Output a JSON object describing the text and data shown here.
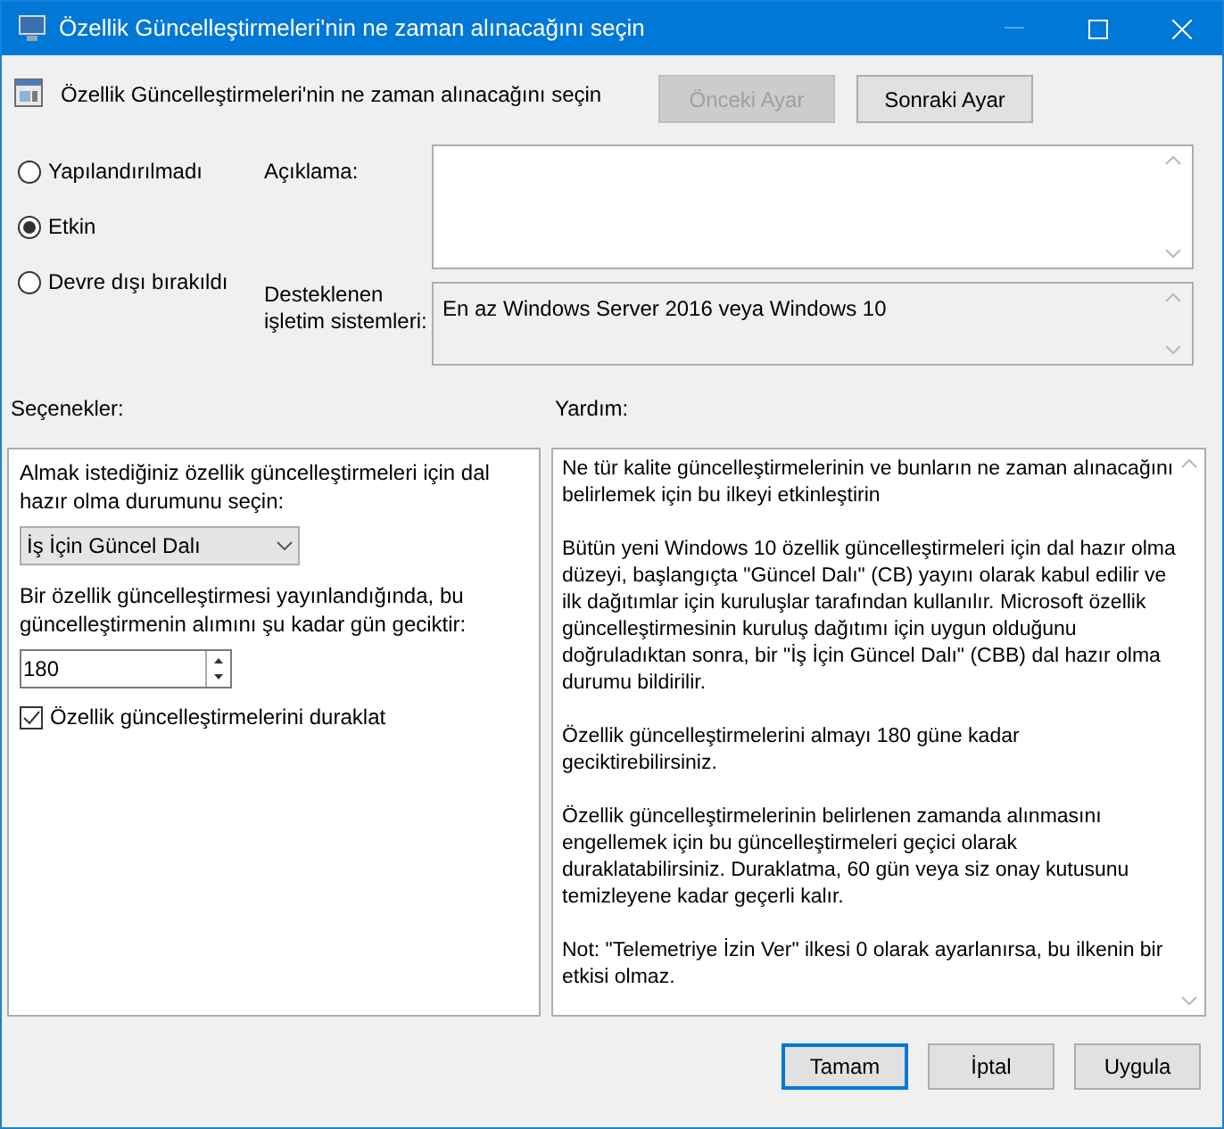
{
  "window": {
    "title": "Özellik Güncelleştirmeleri'nin ne zaman alınacağını seçin"
  },
  "header": {
    "title": "Özellik Güncelleştirmeleri'nin ne zaman alınacağını seçin",
    "buttons": [
      {
        "label": "Önceki Ayar",
        "disabled": true
      },
      {
        "label": "Sonraki Ayar",
        "disabled": false
      }
    ]
  },
  "state_options": [
    {
      "label": "Yapılandırılmadı",
      "selected": false
    },
    {
      "label": "Etkin",
      "selected": true
    },
    {
      "label": "Devre dışı bırakıldı",
      "selected": false
    }
  ],
  "description": {
    "label": "Açıklama:"
  },
  "supported": {
    "label": "Desteklenen işletim sistemleri:",
    "value": "En az Windows Server 2016 veya Windows 10"
  },
  "options": {
    "label": "Seçenekler:",
    "items": [
      {
        "kind": "text",
        "text": "Almak istediğiniz özellik güncelleştirmeleri için dal hazır olma durumunu seçin:"
      },
      {
        "kind": "dropdown",
        "value": "İş İçin Güncel Dalı"
      },
      {
        "kind": "text",
        "text": "Bir özellik güncelleştirmesi yayınlandığında, bu güncelleştirmenin alımını şu kadar gün geciktir:"
      },
      {
        "kind": "spin",
        "value": "180"
      },
      {
        "kind": "checkbox",
        "label": "Özellik güncelleştirmelerini duraklat",
        "checked": true
      }
    ]
  },
  "help": {
    "label": "Yardım:",
    "paragraphs": [
      "Ne tür kalite güncelleştirmelerinin ve bunların ne zaman alınacağını belirlemek için bu ilkeyi etkinleştirin",
      "Bütün yeni Windows 10 özellik güncelleştirmeleri için dal hazır olma düzeyi, başlangıçta \"Güncel Dalı\" (CB) yayını olarak kabul edilir ve ilk dağıtımlar için kuruluşlar tarafından kullanılır. Microsoft özellik güncelleştirmesinin kuruluş dağıtımı için uygun olduğunu doğruladıktan sonra, bir \"İş İçin Güncel Dalı\" (CBB) dal hazır olma durumu bildirilir.",
      "Özellik güncelleştirmelerini almayı 180 güne kadar geciktirebilirsiniz.",
      "Özellik güncelleştirmelerinin belirlenen zamanda alınmasını engellemek için bu güncelleştirmeleri geçici olarak duraklatabilirsiniz. Duraklatma, 60 gün veya siz onay kutusunu temizleyene kadar geçerli kalır.",
      "Not: \"Telemetriye İzin Ver\" ilkesi 0 olarak ayarlanırsa, bu ilkenin bir etkisi olmaz."
    ]
  },
  "footer": {
    "buttons": [
      {
        "label": "Tamam",
        "default": true
      },
      {
        "label": "İptal",
        "default": false
      },
      {
        "label": "Uygula",
        "default": false
      }
    ]
  }
}
